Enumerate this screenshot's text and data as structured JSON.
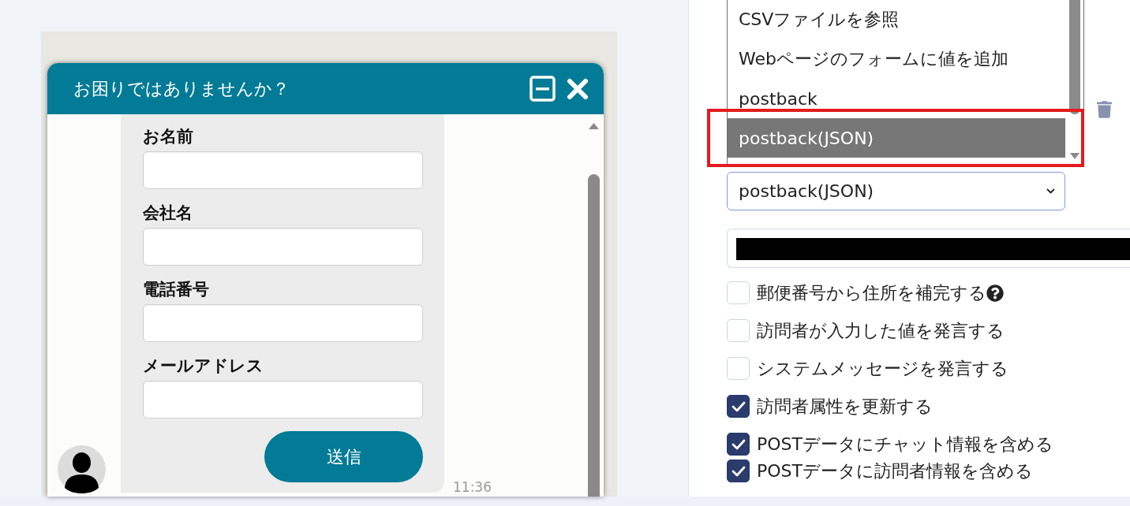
{
  "chat_widget": {
    "title": "お困りではありませんか？",
    "form_fields": [
      {
        "label": "お名前"
      },
      {
        "label": "会社名"
      },
      {
        "label": "電話番号"
      },
      {
        "label": "メールアドレス"
      }
    ],
    "submit_button": "送信",
    "timestamp": "11:36"
  },
  "settings_panel": {
    "action_options": [
      {
        "label": "CSVファイルを参照",
        "selected": false,
        "highlighted": false
      },
      {
        "label": "Webページのフォームに値を追加",
        "selected": false,
        "highlighted": false
      },
      {
        "label": "postback",
        "selected": false,
        "highlighted": false
      },
      {
        "label": "postback(JSON)",
        "selected": true,
        "highlighted": true
      }
    ],
    "action_select": {
      "value": "postback(JSON)"
    },
    "url_field": {
      "redacted": true
    },
    "options": [
      {
        "label": "郵便番号から住所を補完する",
        "checked": false,
        "help": true
      },
      {
        "label": "訪問者が入力した値を発言する",
        "checked": false,
        "help": false
      },
      {
        "label": "システムメッセージを発言する",
        "checked": false,
        "help": false
      },
      {
        "label": "訪問者属性を更新する",
        "checked": true,
        "help": false
      }
    ],
    "post_options": [
      {
        "label": "POSTデータにチャット情報を含める",
        "checked": true,
        "help": false
      },
      {
        "label": "POSTデータに訪問者情報を含める",
        "checked": true,
        "help": false
      }
    ]
  }
}
